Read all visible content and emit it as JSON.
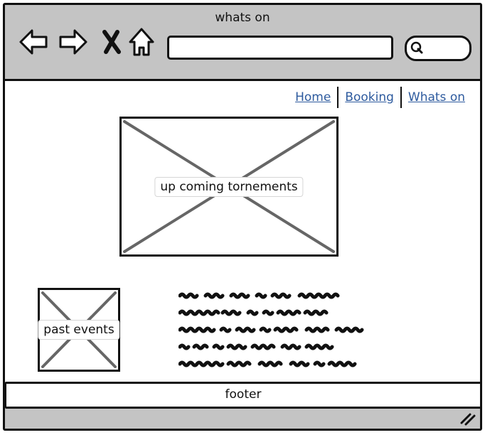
{
  "window": {
    "title": "whats on"
  },
  "toolbar": {
    "icons": [
      "back-arrow-icon",
      "forward-arrow-icon",
      "close-icon",
      "home-icon",
      "search-icon"
    ],
    "url_value": ""
  },
  "nav": {
    "items": [
      {
        "label": "Home"
      },
      {
        "label": "Booking"
      },
      {
        "label": "Whats on"
      }
    ]
  },
  "main": {
    "hero_image_label": "up coming tornements",
    "side_image_label": "past events"
  },
  "footer": {
    "label": "footer"
  },
  "colors": {
    "chrome": "#c4c4c4",
    "link": "#2d5a9e",
    "border": "#111111",
    "placeholder_cross": "#666666"
  }
}
